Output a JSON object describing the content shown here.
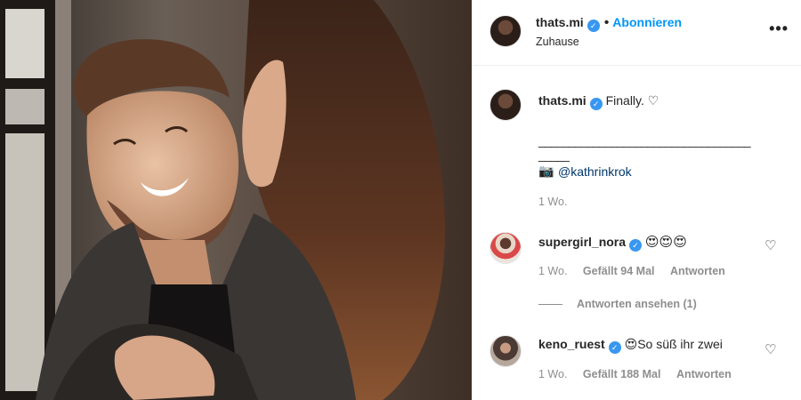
{
  "post": {
    "author": "thats.mi",
    "follow_label": "Abonnieren",
    "location": "Zuhause",
    "more_label": "•••",
    "caption_text": "Finally. ♡",
    "caption_separator": "___________________________________",
    "caption_separator2": "_____",
    "camera_glyph": "📷",
    "caption_mention": "@kathrinkrok",
    "caption_time": "1 Wo."
  },
  "comments": [
    {
      "user": "supergirl_nora",
      "text": "😍😍😍",
      "time": "1 Wo.",
      "likes": "Gefällt 94 Mal",
      "reply_label": "Antworten",
      "view_replies": "Antworten ansehen (1)"
    },
    {
      "user": "keno_ruest",
      "text": "😍So süß ihr zwei",
      "time": "1 Wo.",
      "likes": "Gefällt 188 Mal",
      "reply_label": "Antworten"
    }
  ],
  "icons": {
    "verified": "verified-badge-icon",
    "heart": "heart-outline-icon",
    "more": "more-options-icon",
    "camera": "camera-icon"
  },
  "colors": {
    "accent": "#0095f6",
    "verified": "#3897f0",
    "text": "#262626",
    "muted": "#8e8e8e"
  }
}
